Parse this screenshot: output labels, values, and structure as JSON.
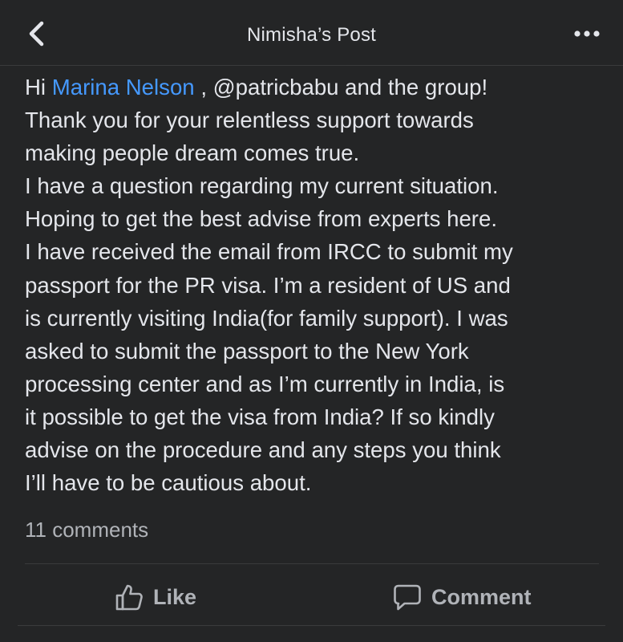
{
  "header": {
    "title": "Nimisha’s Post",
    "back_icon": "chevron-left-icon",
    "more_icon": "more-dots-icon"
  },
  "post": {
    "greeting": "Hi",
    "mention_name": "Marina Nelson",
    "line1_rest": " , @patricbabu and the group!",
    "lines": [
      "Thank you for your relentless support towards",
      "making people dream comes true.",
      "I have a question regarding my current situation.",
      "Hoping to get the best advise from experts here.",
      "I have received the email from IRCC to submit my",
      "passport for the PR visa. I’m a resident of US and",
      "is currently visiting India(for family support). I was",
      "asked to submit the passport to the New York",
      "processing center and as I’m currently in India, is",
      "it possible to get the visa from India? If so kindly",
      "advise on the procedure and any steps you think",
      "I’ll have to be cautious about."
    ],
    "comments_count": "11 comments"
  },
  "actions": {
    "like_label": "Like",
    "comment_label": "Comment"
  },
  "colors": {
    "background": "#242526",
    "text": "#e4e6eb",
    "secondary_text": "#b0b3b8",
    "mention": "#4599ff",
    "divider": "#3a3b3c"
  }
}
